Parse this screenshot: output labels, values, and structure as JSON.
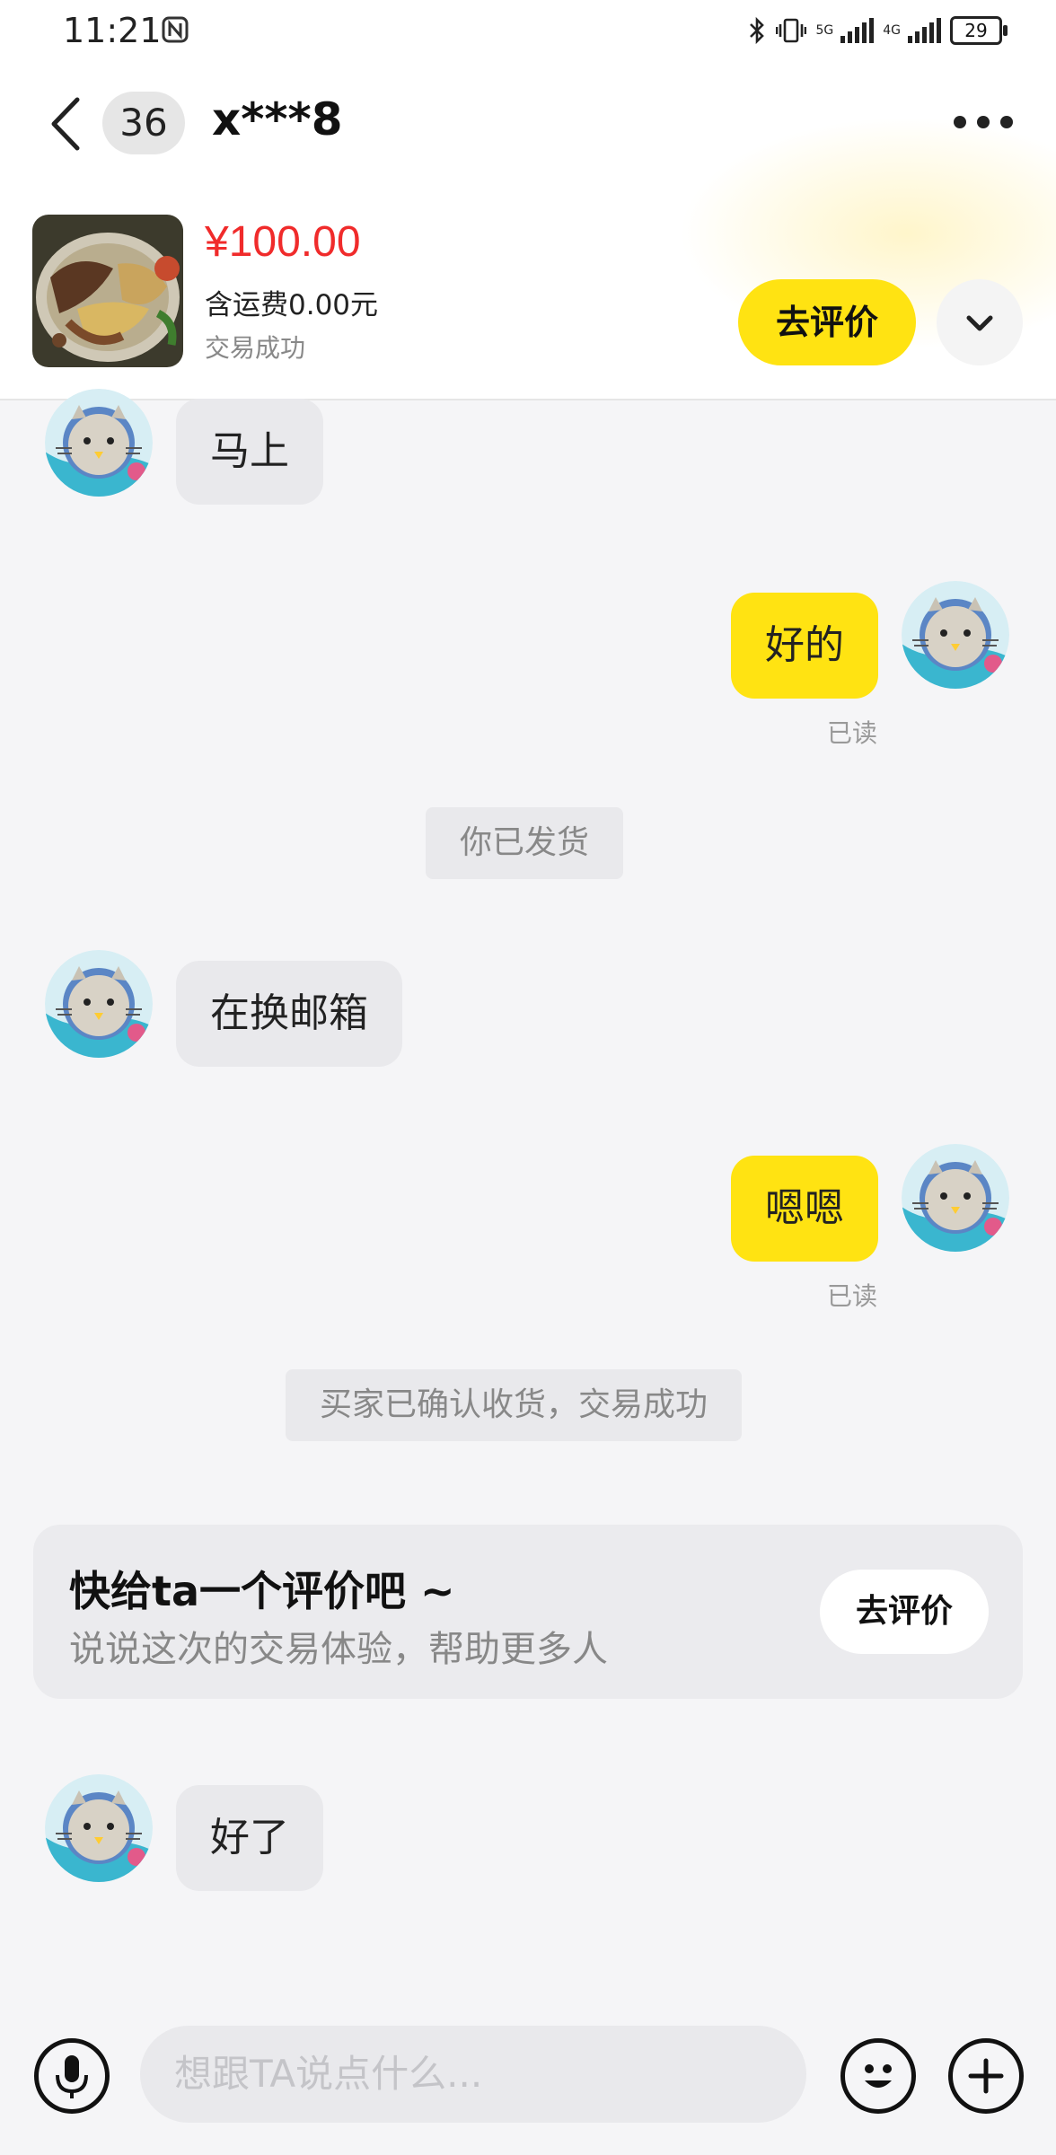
{
  "status_bar": {
    "time": "11:21",
    "network_5g": "5G",
    "network_4g": "4G",
    "battery": "29"
  },
  "header": {
    "unread_count": "36",
    "title": "x***8"
  },
  "product": {
    "price": "¥100.00",
    "shipping": "含运费0.00元",
    "status": "交易成功",
    "review_button": "去评价"
  },
  "messages": {
    "m1": "马上",
    "m2": "好的",
    "m2_read": "已读",
    "sys1": "你已发货",
    "m3": "在换邮箱",
    "m4": "嗯嗯",
    "m4_read": "已读",
    "sys2": "买家已确认收货，交易成功",
    "m5": "好了"
  },
  "review_card": {
    "title": "快给ta一个评价吧 ~",
    "subtitle": "说说这次的交易体验，帮助更多人",
    "button": "去评价"
  },
  "input_bar": {
    "placeholder": "想跟TA说点什么..."
  },
  "colors": {
    "accent": "#ffe312",
    "price": "#f02b2b"
  }
}
